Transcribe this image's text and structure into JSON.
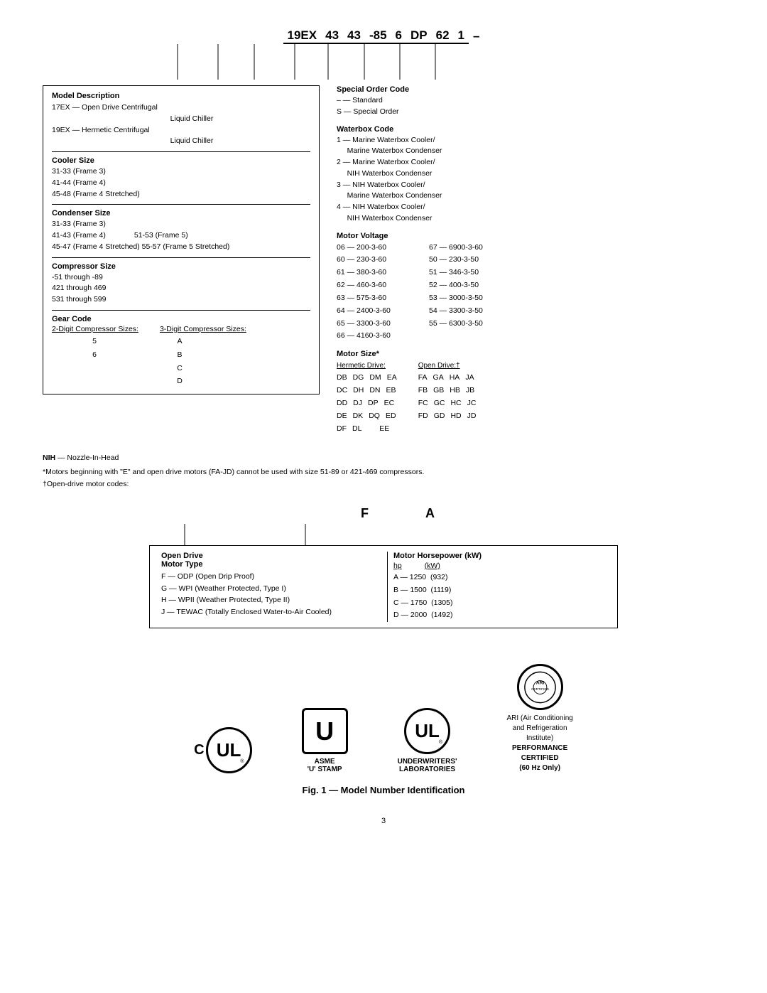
{
  "page": {
    "title": "Fig. 1 — Model Number Identification",
    "page_number": "3"
  },
  "model_number": {
    "segments": [
      "19EX",
      "43",
      "43",
      "-85",
      "6",
      "DP",
      "62",
      "1",
      "–"
    ],
    "display": "19EX  43  43  -85  6  DP  62  1  –"
  },
  "left_sections": {
    "model_description": {
      "title": "Model Description",
      "items": [
        "17EX — Open Drive Centrifugal",
        "Liquid Chiller",
        "19EX — Hermetic Centrifugal",
        "Liquid Chiller"
      ]
    },
    "cooler_size": {
      "title": "Cooler Size",
      "items": [
        "31-33 (Frame 3)",
        "41-44 (Frame 4)",
        "45-48 (Frame 4 Stretched)"
      ]
    },
    "condenser_size": {
      "title": "Condenser Size",
      "items": [
        "31-33 (Frame 3)",
        "41-43 (Frame 4)    51-53 (Frame 5)",
        "45-47 (Frame 4 Stretched)  55-57 (Frame 5 Stretched)"
      ]
    },
    "compressor_size": {
      "title": "Compressor Size",
      "items": [
        "-51 through -89",
        "421 through 469",
        "531 through 599"
      ]
    },
    "gear_code": {
      "title": "Gear Code",
      "col1_header": "2-Digit Compressor Sizes:",
      "col2_header": "3-Digit Compressor Sizes:",
      "col1_values": [
        "5",
        "6"
      ],
      "col2_values": [
        "A",
        "B",
        "C",
        "D"
      ]
    }
  },
  "right_sections": {
    "special_order": {
      "title": "Special Order Code",
      "items": [
        "– — Standard",
        "S — Special Order"
      ]
    },
    "waterbox_code": {
      "title": "Waterbox Code",
      "items": [
        "1 — Marine Waterbox Cooler/ Marine Waterbox Condenser",
        "2 — Marine Waterbox Cooler/ NIH Waterbox Condenser",
        "3 — NIH Waterbox Cooler/ Marine Waterbox Condenser",
        "4 — NIH Waterbox Cooler/ NIH Waterbox Condenser"
      ]
    },
    "motor_voltage": {
      "title": "Motor Voltage",
      "entries_col1": [
        "06 — 200-3-60",
        "60 — 230-3-60",
        "61 — 380-3-60",
        "62 — 460-3-60",
        "63 — 575-3-60",
        "64 — 2400-3-60",
        "65 — 3300-3-60",
        "66 — 4160-3-60"
      ],
      "entries_col2": [
        "67 — 6900-3-60",
        "50 — 230-3-50",
        "51 — 346-3-50",
        "52 — 400-3-50",
        "53 — 3000-3-50",
        "54 — 3300-3-50",
        "55 — 6300-3-50"
      ]
    },
    "motor_size": {
      "title": "Motor Size*",
      "hermetic_label": "Hermetic Drive:",
      "open_label": "Open Drive:†",
      "hermetic_rows": [
        [
          "DB",
          "DG",
          "DM",
          "EA"
        ],
        [
          "DC",
          "DH",
          "DN",
          "EB"
        ],
        [
          "DD",
          "DJ",
          "DP",
          "EC"
        ],
        [
          "DE",
          "DK",
          "DQ",
          "ED"
        ],
        [
          "DF",
          "DL",
          "",
          "EE"
        ]
      ],
      "open_rows": [
        [
          "FA",
          "GA",
          "HA",
          "JA"
        ],
        [
          "FB",
          "GB",
          "HB",
          "JB"
        ],
        [
          "FC",
          "GC",
          "HC",
          "JC"
        ],
        [
          "FD",
          "GD",
          "HD",
          "JD"
        ]
      ]
    }
  },
  "notes": {
    "nih": "NIH — Nozzle-In-Head",
    "motors_note": "*Motors beginning with \"E\" and open drive motors (FA-JD) cannot be used with size 51-89 or 421-469 compressors.",
    "open_drive_note": "†Open-drive motor codes:"
  },
  "open_drive_section": {
    "header_letters": [
      "F",
      "A"
    ],
    "motor_type": {
      "title": "Open Drive Motor Type",
      "items": [
        "F — ODP (Open Drip Proof)",
        "G — WPI (Weather Protected, Type I)",
        "H — WPII (Weather Protected, Type II)",
        "J — TEWAC (Totally Enclosed Water-to-Air Cooled)"
      ]
    },
    "motor_hp": {
      "title": "Motor Horsepower (kW)",
      "hp_label": "hp",
      "kw_label": "(kW)",
      "entries": [
        {
          "letter": "A",
          "hp": "1250",
          "kw": "(932)"
        },
        {
          "letter": "B",
          "hp": "1500",
          "kw": "(1119)"
        },
        {
          "letter": "C",
          "hp": "1750",
          "kw": "(1305)"
        },
        {
          "letter": "D",
          "hp": "2000",
          "kw": "(1492)"
        }
      ]
    }
  },
  "logos": [
    {
      "type": "ul_c",
      "label": "C UL®",
      "description": ""
    },
    {
      "type": "asme",
      "label": "ASME\n'U' STAMP",
      "description": ""
    },
    {
      "type": "ul",
      "label": "UNDERWRITERS'\nLABORATORIES",
      "description": ""
    },
    {
      "type": "ari",
      "label": "ARI (Air Conditioning\nand Refrigeration\nInstitute)\nPERFORMANCE\nCERTIFIED\n(60 Hz Only)",
      "description": ""
    }
  ],
  "figure_caption": "Fig. 1 — Model Number Identification"
}
